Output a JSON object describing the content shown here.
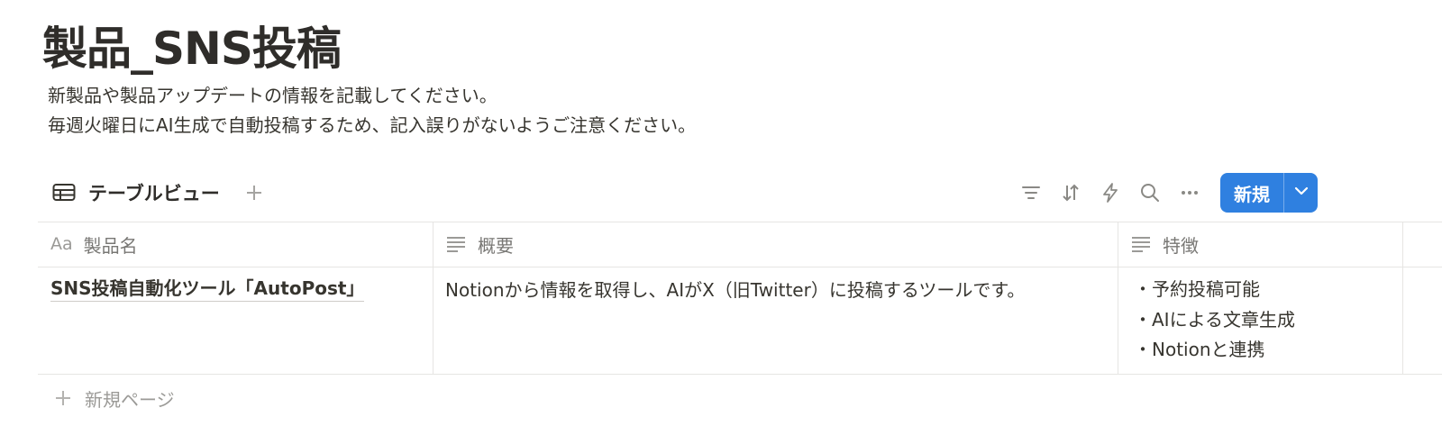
{
  "page": {
    "title": "製品_SNS投稿",
    "description_line1": "新製品や製品アップデートの情報を記載してください。",
    "description_line2": "毎週火曜日にAI生成で自動投稿するため、記入誤りがないようご注意ください。"
  },
  "view": {
    "tab_label": "テーブルビュー",
    "tab_icon": "table-icon",
    "toolbar_icons": [
      "filter-icon",
      "sort-icon",
      "automation-icon",
      "search-icon",
      "more-icon"
    ],
    "new_button_label": "新規"
  },
  "table": {
    "columns": [
      {
        "label": "製品名",
        "icon_text": "Aa"
      },
      {
        "label": "概要",
        "icon": "text-lines-icon"
      },
      {
        "label": "特徴",
        "icon": "text-lines-icon"
      }
    ],
    "rows": [
      {
        "name": "SNS投稿自動化ツール「AutoPost」",
        "summary": "Notionから情報を取得し、AIがX（旧Twitter）に投稿するツールです。",
        "features": [
          "・予約投稿可能",
          "・AIによる文章生成",
          "・Notionと連携"
        ]
      }
    ],
    "new_page_label": "新規ページ"
  },
  "colors": {
    "accent": "#2f80e0",
    "text": "#37352f",
    "muted": "#787774",
    "border": "#e6e5e3"
  }
}
